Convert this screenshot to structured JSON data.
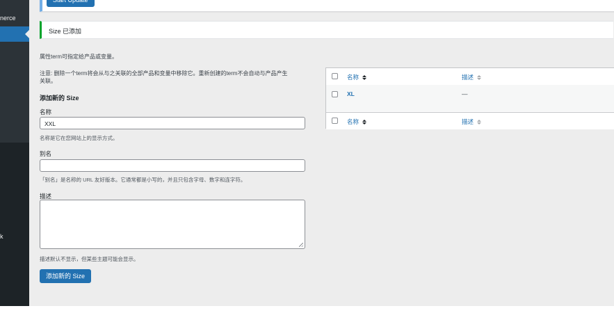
{
  "sidebar": {
    "menu_label": "nerce",
    "bottom_label": "k"
  },
  "notices": {
    "update_button": "Start Update",
    "success_message": "Size 已添加"
  },
  "form": {
    "intro": "属性term可指定给产品或变量。",
    "note_line1": "注意: 删除一个term将会从与之关联的全部产品和变量中移除它。重新创建的term不会自动与产品产生",
    "note_line2": "关联。",
    "heading": "添加新的 Size",
    "name_label": "名称",
    "name_value": "XXL",
    "name_desc": "名称是它在您网站上的显示方式。",
    "slug_label": "别名",
    "slug_value": "",
    "slug_desc": "「别名」是名称的 URL 友好版本。它通常都是小写的，并且只包含字母、数字和连字符。",
    "desc_label": "描述",
    "desc_help": "描述默认不显示，但某些主题可能会显示。",
    "submit_label": "添加新的 Size"
  },
  "table": {
    "col_name": "名称",
    "col_desc": "描述",
    "rows": [
      {
        "name": "XL",
        "description": "—"
      }
    ]
  }
}
